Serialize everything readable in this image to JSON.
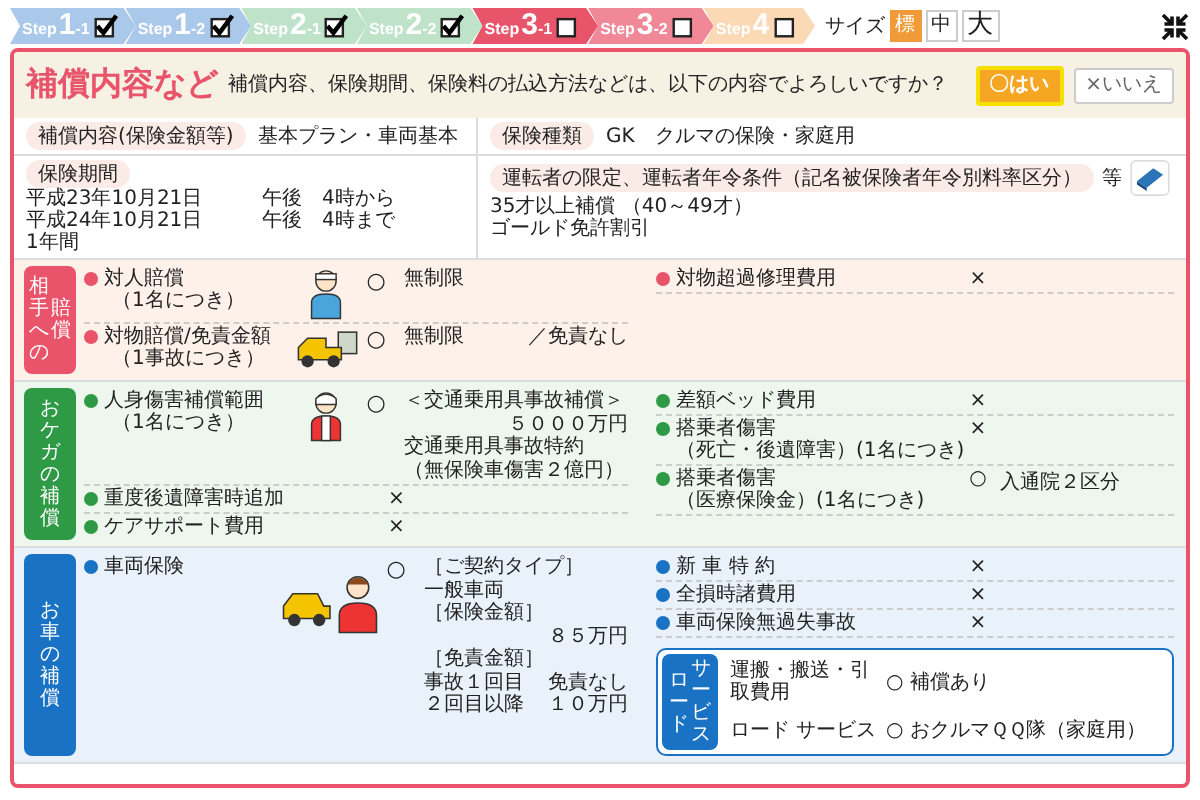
{
  "steps": [
    {
      "label": "Step",
      "number": "1",
      "sub": "-1",
      "checked": true,
      "color": "#a9c8ea"
    },
    {
      "label": "Step",
      "number": "1",
      "sub": "-2",
      "checked": true,
      "color": "#a9c8ea"
    },
    {
      "label": "Step",
      "number": "2",
      "sub": "-1",
      "checked": true,
      "color": "#bfe3c8"
    },
    {
      "label": "Step",
      "number": "2",
      "sub": "-2",
      "checked": true,
      "color": "#bfe3c8"
    },
    {
      "label": "Step",
      "number": "3",
      "sub": "-1",
      "checked": false,
      "color": "#e8546a"
    },
    {
      "label": "Step",
      "number": "3",
      "sub": "-2",
      "checked": false,
      "color": "#f08898"
    },
    {
      "label": "Step",
      "number": "4",
      "checked": false,
      "color": "#fbd9b5"
    }
  ],
  "size": {
    "label": "サイズ",
    "options": [
      {
        "label": "標",
        "selected": true
      },
      {
        "label": "中",
        "selected": false
      },
      {
        "label": "大",
        "selected": false
      }
    ]
  },
  "header": {
    "title": "補償内容など",
    "question": "補償内容、保険期間、保険料の払込方法などは、以下の内容でよろしいですか？",
    "answers": [
      {
        "label": "〇はい",
        "selected": true
      },
      {
        "label": "×いいえ",
        "selected": false
      }
    ]
  },
  "info": {
    "plan": {
      "label": "補償内容(保険金額等)",
      "value": "基本プラン・車両基本"
    },
    "type": {
      "label": "保険種類",
      "value": "GK　クルマの保険・家庭用"
    },
    "period": {
      "label": "保険期間",
      "lines": [
        {
          "date": "平成23年10月21日",
          "time": "午後　4時から"
        },
        {
          "date": "平成24年10月21日",
          "time": "午後　4時まで"
        },
        {
          "date": "1年間"
        }
      ]
    },
    "driver": {
      "label": "運転者の限定、運転者年令条件（記名被保険者年令別料率区分）",
      "suffix": "等",
      "lines": [
        "35才以上補償 （40～49才）",
        "ゴールド免許割引"
      ]
    }
  },
  "sections": [
    {
      "label_columns": [
        "相手への",
        "賠償"
      ],
      "color": "#e9546b",
      "left": [
        {
          "kind": "person",
          "name": "対人賠償",
          "note": "（1名につき）",
          "mark": "○",
          "lines": [
            {
              "left": "無制限"
            }
          ]
        },
        {
          "kind": "loader",
          "name": "対物賠償/免責金額",
          "note": "（1事故につき）",
          "mark": "○",
          "lines": [
            {
              "left": "無制限",
              "right": "／免責なし"
            }
          ]
        }
      ],
      "right": [
        {
          "name": "対物超過修理費用",
          "mark": "×"
        }
      ]
    },
    {
      "label_columns": [
        "おケガの補償"
      ],
      "color": "#2e9a46",
      "left": [
        {
          "kind": "bandaged",
          "name": "人身傷害補償範囲",
          "note": "（1名につき）",
          "mark": "○",
          "lines": [
            {
              "left": "＜交通乗用具事故補償＞"
            },
            {
              "right": "５０００万円"
            },
            {
              "left": "交通乗用具事故特約"
            },
            {
              "left": "（無保険車傷害２億円）"
            }
          ]
        },
        {
          "kind": "simple",
          "name": "重度後遺障害時追加",
          "mark": "×"
        },
        {
          "kind": "simple",
          "name": "ケアサポート費用",
          "mark": "×"
        }
      ],
      "right": [
        {
          "name": "差額ベッド費用",
          "mark": "×"
        },
        {
          "name": "搭乗者傷害",
          "note": "（死亡・後遺障害）(1名につき)",
          "mark": "×"
        },
        {
          "name": "搭乗者傷害",
          "note": "（医療保険金）(1名につき)",
          "mark": "○",
          "value": "入通院２区分"
        }
      ]
    },
    {
      "label_columns": [
        "お車の補償"
      ],
      "color": "#1a72c4",
      "left": [
        {
          "kind": "car",
          "name": "車両保険",
          "mark": "○",
          "lines": [
            {
              "left": "［ご契約タイプ］"
            },
            {
              "left": "一般車両"
            },
            {
              "left": "［保険金額］"
            },
            {
              "right": "８５万円"
            },
            {
              "left": "［免責金額］"
            },
            {
              "left": "事故１回目",
              "right": "免責なし"
            },
            {
              "left": "２回目以降",
              "right": "１０万円"
            }
          ]
        }
      ],
      "right": [
        {
          "name": "新 車 特 約",
          "mark": "×"
        },
        {
          "name": "全損時諸費用",
          "mark": "×"
        },
        {
          "name": "車両保険無過失事故",
          "mark": "×"
        }
      ],
      "road_service": {
        "label_columns": [
          "ロード",
          "サービス"
        ],
        "rows": [
          {
            "name": "運搬・搬送・引取費用",
            "mark": "○",
            "value": "補償あり"
          },
          {
            "name": "ロード サービス",
            "mark": "○",
            "value": "おクルマＱＱ隊（家庭用）"
          }
        ]
      }
    }
  ]
}
